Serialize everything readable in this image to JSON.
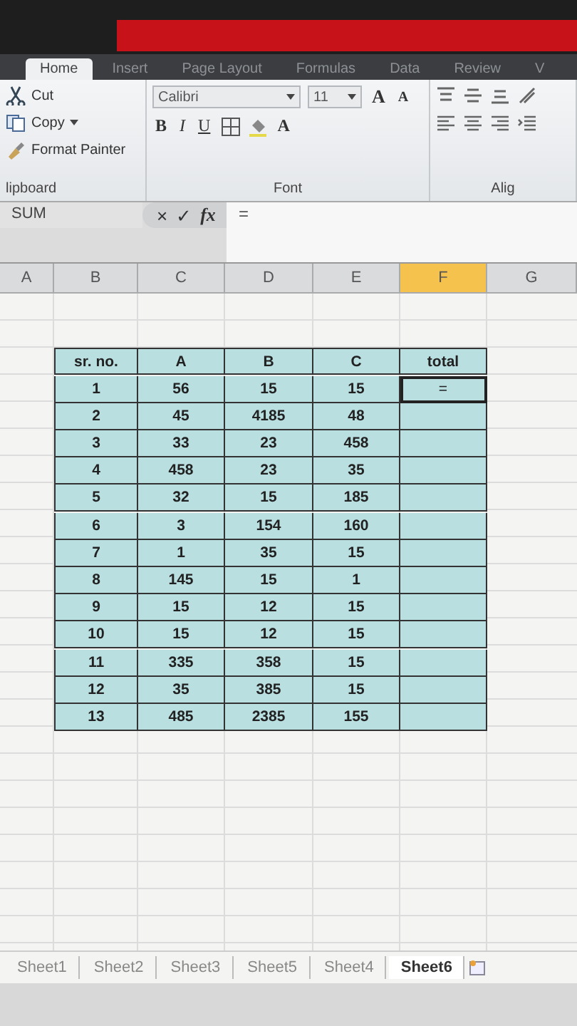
{
  "ribbon_tabs": [
    {
      "label": "Home",
      "selected": true
    },
    {
      "label": "Insert",
      "selected": false
    },
    {
      "label": "Page Layout",
      "selected": false
    },
    {
      "label": "Formulas",
      "selected": false
    },
    {
      "label": "Data",
      "selected": false
    },
    {
      "label": "Review",
      "selected": false
    },
    {
      "label": "V",
      "selected": false
    }
  ],
  "clipboard": {
    "cut": "Cut",
    "copy": "Copy",
    "format_painter": "Format Painter",
    "group_label": "lipboard"
  },
  "font": {
    "font_name": "Calibri",
    "font_size": "11",
    "bold": "B",
    "italic": "I",
    "underline": "U",
    "grow": "A",
    "shrink": "A",
    "font_color": "A",
    "group_label": "Font"
  },
  "alignment": {
    "group_label": "Alig"
  },
  "formula_bar": {
    "name_box": "SUM",
    "cancel": "×",
    "enter": "✓",
    "fx": "fx",
    "formula": "="
  },
  "columns": [
    {
      "label": "A",
      "selected": false
    },
    {
      "label": "B",
      "selected": false
    },
    {
      "label": "C",
      "selected": false
    },
    {
      "label": "D",
      "selected": false
    },
    {
      "label": "E",
      "selected": false
    },
    {
      "label": "F",
      "selected": true
    },
    {
      "label": "G",
      "selected": false
    }
  ],
  "table": {
    "headers": [
      "sr. no.",
      "A",
      "B",
      "C",
      "total"
    ],
    "rows": [
      [
        "1",
        "56",
        "15",
        "15",
        "="
      ],
      [
        "2",
        "45",
        "4185",
        "48",
        ""
      ],
      [
        "3",
        "33",
        "23",
        "458",
        ""
      ],
      [
        "4",
        "458",
        "23",
        "35",
        ""
      ],
      [
        "5",
        "32",
        "15",
        "185",
        ""
      ],
      [
        "6",
        "3",
        "154",
        "160",
        ""
      ],
      [
        "7",
        "1",
        "35",
        "15",
        ""
      ],
      [
        "8",
        "145",
        "15",
        "1",
        ""
      ],
      [
        "9",
        "15",
        "12",
        "15",
        ""
      ],
      [
        "10",
        "15",
        "12",
        "15",
        ""
      ],
      [
        "11",
        "335",
        "358",
        "15",
        ""
      ],
      [
        "12",
        "35",
        "385",
        "15",
        ""
      ],
      [
        "13",
        "485",
        "2385",
        "155",
        ""
      ]
    ]
  },
  "sheet_tabs": [
    {
      "label": "Sheet1",
      "selected": false
    },
    {
      "label": "Sheet2",
      "selected": false
    },
    {
      "label": "Sheet3",
      "selected": false
    },
    {
      "label": "Sheet5",
      "selected": false
    },
    {
      "label": "Sheet4",
      "selected": false
    },
    {
      "label": "Sheet6",
      "selected": true
    }
  ]
}
